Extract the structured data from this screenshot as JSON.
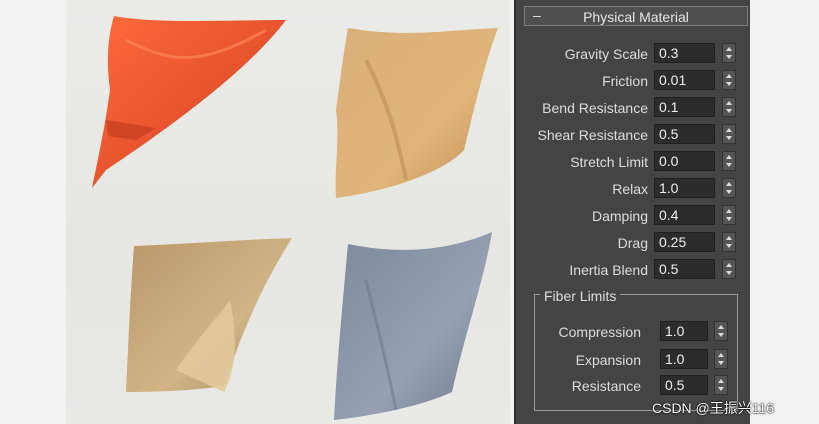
{
  "panel": {
    "toggle": "–",
    "title": "Physical Material",
    "params": [
      {
        "label": "Gravity Scale",
        "value": "0.3"
      },
      {
        "label": "Friction",
        "value": "0.01"
      },
      {
        "label": "Bend Resistance",
        "value": "0.1"
      },
      {
        "label": "Shear Resistance",
        "value": "0.5"
      },
      {
        "label": "Stretch Limit",
        "value": "0.0"
      },
      {
        "label": "Relax",
        "value": "1.0"
      },
      {
        "label": "Damping",
        "value": "0.4"
      },
      {
        "label": "Drag",
        "value": "0.25"
      },
      {
        "label": "Inertia Blend",
        "value": "0.5"
      }
    ],
    "fiber_limits": {
      "title": "Fiber Limits",
      "params": [
        {
          "label": "Compression",
          "value": "1.0"
        },
        {
          "label": "Expansion",
          "value": "1.0"
        },
        {
          "label": "Resistance",
          "value": "0.5"
        }
      ]
    }
  },
  "watermark": "CSDN @王振兴116",
  "colors": {
    "cloth_red": "#e8552e",
    "cloth_tan": "#d7ad74",
    "cloth_burlap": "#c9ad7f",
    "cloth_blue": "#8a94a6",
    "panel_bg": "#444444"
  }
}
